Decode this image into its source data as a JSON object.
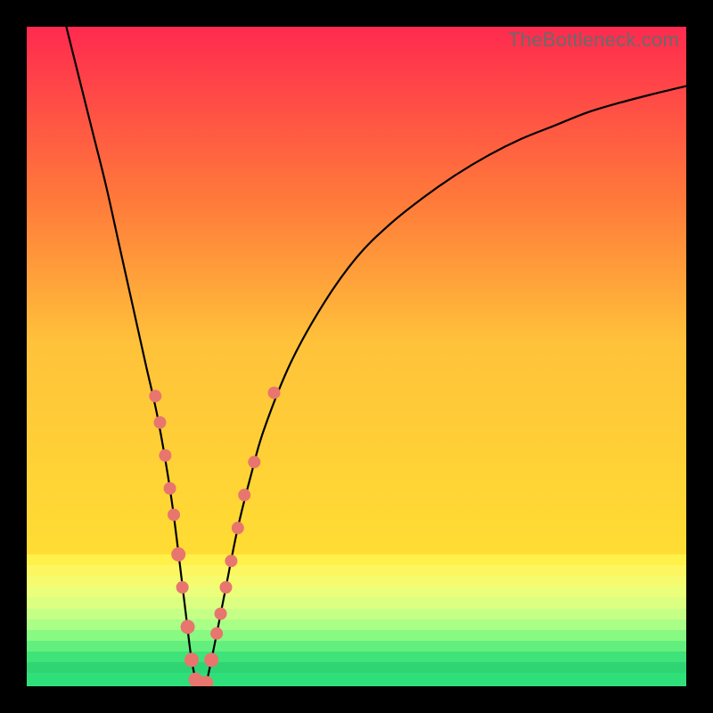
{
  "watermark": "TheBottleneck.com",
  "chart_data": {
    "type": "line",
    "title": "",
    "xlabel": "",
    "ylabel": "",
    "xlim": [
      0,
      100
    ],
    "ylim": [
      0,
      100
    ],
    "grid": false,
    "series": [
      {
        "name": "bottleneck-curve",
        "x": [
          6,
          8,
          10,
          12,
          14,
          16,
          18,
          20,
          22,
          24,
          25,
          26,
          27,
          28,
          30,
          32,
          34,
          36,
          40,
          45,
          50,
          55,
          60,
          65,
          70,
          75,
          80,
          85,
          90,
          95,
          100
        ],
        "y": [
          100,
          92,
          84,
          76,
          67,
          58,
          49,
          40,
          28,
          12,
          4,
          0,
          0,
          4,
          14,
          24,
          32,
          39,
          49,
          58,
          65,
          70,
          74,
          77.5,
          80.5,
          83,
          85,
          87,
          88.5,
          89.8,
          91
        ]
      }
    ],
    "markers": [
      {
        "x": 19.5,
        "y": 44,
        "r": 7
      },
      {
        "x": 20.2,
        "y": 40,
        "r": 7
      },
      {
        "x": 21.0,
        "y": 35,
        "r": 7
      },
      {
        "x": 21.7,
        "y": 30,
        "r": 7
      },
      {
        "x": 22.3,
        "y": 26,
        "r": 7
      },
      {
        "x": 23.0,
        "y": 20,
        "r": 8
      },
      {
        "x": 23.6,
        "y": 15,
        "r": 7
      },
      {
        "x": 24.4,
        "y": 9,
        "r": 8
      },
      {
        "x": 25.0,
        "y": 4,
        "r": 8
      },
      {
        "x": 25.6,
        "y": 1,
        "r": 8
      },
      {
        "x": 26.4,
        "y": 0,
        "r": 8
      },
      {
        "x": 27.2,
        "y": 0.5,
        "r": 8
      },
      {
        "x": 28.0,
        "y": 4,
        "r": 8
      },
      {
        "x": 28.8,
        "y": 8,
        "r": 7
      },
      {
        "x": 29.4,
        "y": 11,
        "r": 7
      },
      {
        "x": 30.2,
        "y": 15,
        "r": 7
      },
      {
        "x": 31.0,
        "y": 19,
        "r": 7
      },
      {
        "x": 32.0,
        "y": 24,
        "r": 7
      },
      {
        "x": 33.0,
        "y": 29,
        "r": 7
      },
      {
        "x": 34.5,
        "y": 34,
        "r": 7
      },
      {
        "x": 37.5,
        "y": 44.5,
        "r": 7
      }
    ],
    "pills": [
      {
        "x1": 19.2,
        "y1": 46,
        "x2": 22.0,
        "y2": 28,
        "w": 14
      },
      {
        "x1": 22.8,
        "y1": 22,
        "x2": 25.2,
        "y2": 3,
        "w": 16
      },
      {
        "x1": 25.6,
        "y1": 1,
        "x2": 28.2,
        "y2": 5,
        "w": 16
      },
      {
        "x1": 28.6,
        "y1": 7,
        "x2": 30.6,
        "y2": 17,
        "w": 14
      },
      {
        "x1": 31.2,
        "y1": 20,
        "x2": 33.4,
        "y2": 30,
        "w": 14
      }
    ],
    "background_gradient": {
      "top_color": "#ff2a4f",
      "mid_color": "#ffdd33",
      "bottom_color": "#2fe07a",
      "bands_start_pct": 80
    }
  }
}
